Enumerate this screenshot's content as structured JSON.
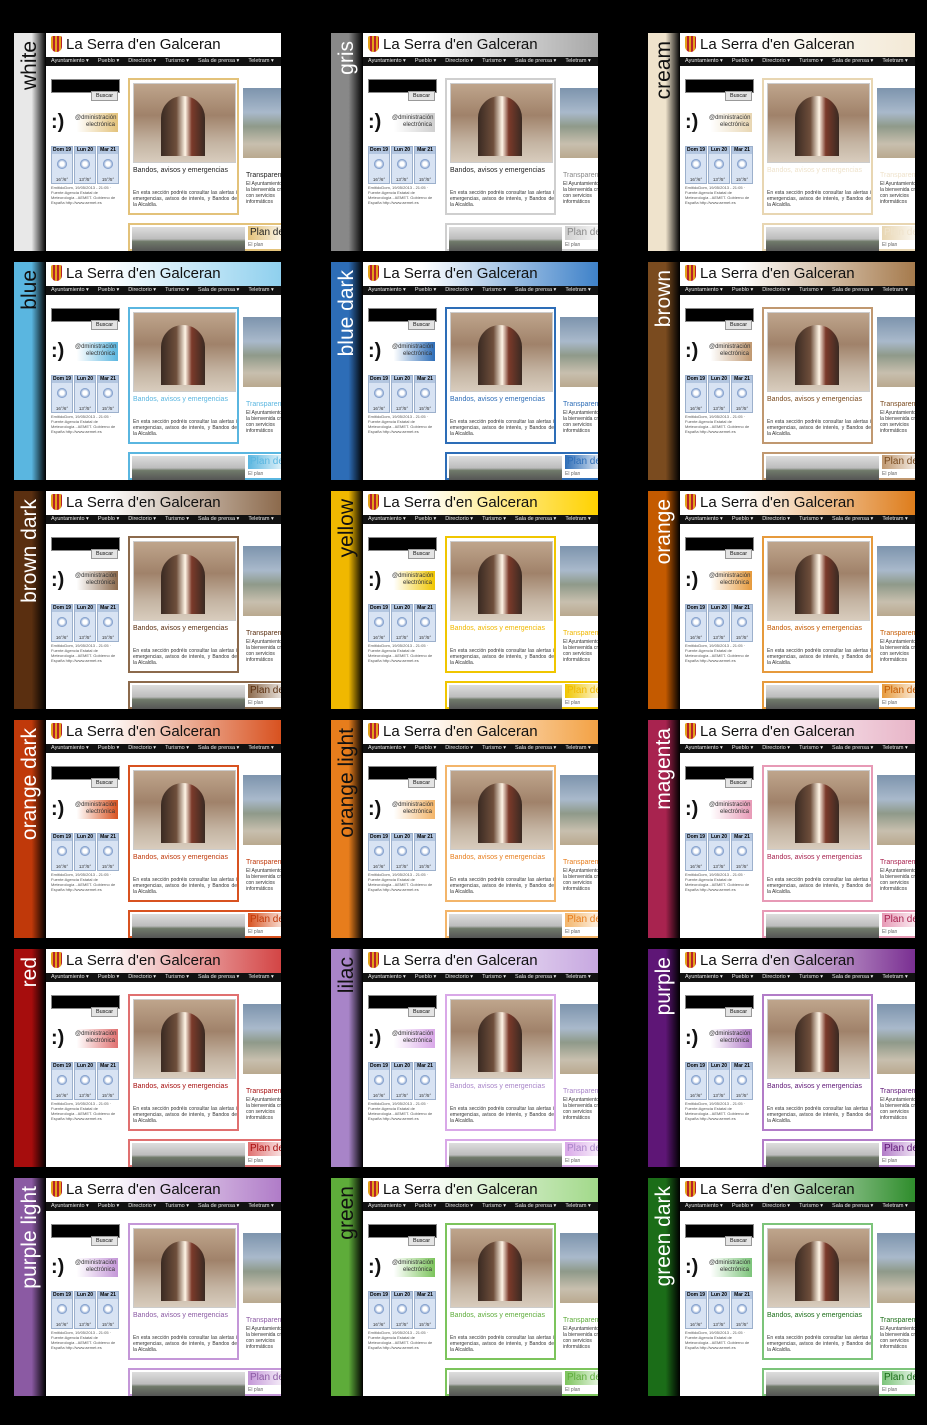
{
  "site": {
    "title": "La Serra d'en Galceran",
    "nav": [
      "Ayuntamiento",
      "Pueblo",
      "Directorio",
      "Turismo",
      "Sala de prensa",
      "Teletram"
    ],
    "search_button": "Buscar",
    "smiley": ":)",
    "admin_banner": "@dministración electrónica",
    "weather_days": [
      {
        "day": "Dom 19",
        "temp": "16°/6°"
      },
      {
        "day": "Lun 20",
        "temp": "13°/5°"
      },
      {
        "day": "Mar 21",
        "temp": "15°/5°"
      }
    ],
    "weather_small": "EmitidoDom, 19/05/2013 - 21:05 · Fuente:Agencia Estatal de Meteorología - AEMET. Gobierno de España http://www.aemet.es",
    "featured_title": "Bandos, avisos y emergencias",
    "featured_text": "En esta sección podréis consultar las alertas i emergencias, avisos de interés, y Bandos de la Alcaldía.",
    "col3_title": "Transparencia",
    "col3_text": "El Ayuntamiento os da la bienvenida creado con servicios informáticos",
    "bottom_title": "Plan de",
    "bottom_sub": "El plan"
  },
  "themes": [
    {
      "name": "white",
      "side": "#e8e8e8",
      "head": "#ffffff",
      "accent": "#e3c27a",
      "label": "#111111"
    },
    {
      "name": "gris",
      "side": "#888888",
      "head": "#a8a8a8",
      "accent": "#cfcfcf",
      "label": "#ffffff"
    },
    {
      "name": "cream",
      "side": "#efe3cc",
      "head": "#f3e9d6",
      "accent": "#e8d6b2",
      "label": "#111111"
    },
    {
      "name": "blue",
      "side": "#5ab6e0",
      "head": "#8fd0ee",
      "accent": "#5ab6e0",
      "label": "#111111"
    },
    {
      "name": "blue dark",
      "side": "#2d6db7",
      "head": "#3f82c9",
      "accent": "#2d6db7",
      "label": "#ffffff"
    },
    {
      "name": "brown",
      "side": "#7a4b1f",
      "head": "#a67b4d",
      "accent": "#c09870",
      "label": "#ffffff"
    },
    {
      "name": "brown dark",
      "side": "#5a2f10",
      "head": "#8c6a4c",
      "accent": "#8c6a4c",
      "label": "#ffffff"
    },
    {
      "name": "yellow",
      "side": "#f0b800",
      "head": "#ffd200",
      "accent": "#f0c600",
      "label": "#111111"
    },
    {
      "name": "orange",
      "side": "#c45a00",
      "head": "#de7d1c",
      "accent": "#e69a3c",
      "label": "#ffffff"
    },
    {
      "name": "orange dark",
      "side": "#c0390a",
      "head": "#d85220",
      "accent": "#d85220",
      "label": "#ffffff"
    },
    {
      "name": "orange light",
      "side": "#e77d1c",
      "head": "#f3a245",
      "accent": "#f3b56a",
      "label": "#111111"
    },
    {
      "name": "magenta",
      "side": "#a8234f",
      "head": "#e8b5c8",
      "accent": "#e79ab6",
      "label": "#ffffff"
    },
    {
      "name": "red",
      "side": "#a60d0d",
      "head": "#d34545",
      "accent": "#e07070",
      "label": "#ffffff"
    },
    {
      "name": "lilac",
      "side": "#a884c8",
      "head": "#c7a8e0",
      "accent": "#d9a8e8",
      "label": "#111111"
    },
    {
      "name": "purple",
      "side": "#5e1676",
      "head": "#7a2f92",
      "accent": "#b27cc8",
      "label": "#ffffff"
    },
    {
      "name": "purple light",
      "side": "#8b5aa3",
      "head": "#b07cc8",
      "accent": "#c497d8",
      "label": "#ffffff"
    },
    {
      "name": "green",
      "side": "#5eac3a",
      "head": "#a2d98a",
      "accent": "#7cc45c",
      "label": "#111111"
    },
    {
      "name": "green dark",
      "side": "#1b6d18",
      "head": "#2f8d2c",
      "accent": "#7cc47a",
      "label": "#ffffff"
    }
  ]
}
